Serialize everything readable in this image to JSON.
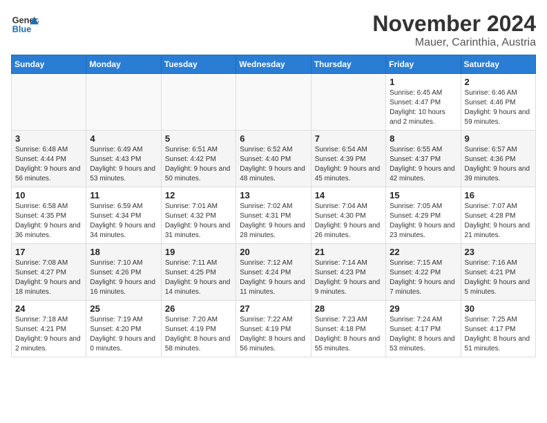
{
  "header": {
    "logo_general": "General",
    "logo_blue": "Blue",
    "month": "November 2024",
    "location": "Mauer, Carinthia, Austria"
  },
  "weekdays": [
    "Sunday",
    "Monday",
    "Tuesday",
    "Wednesday",
    "Thursday",
    "Friday",
    "Saturday"
  ],
  "weeks": [
    [
      {
        "day": "",
        "sunrise": "",
        "sunset": "",
        "daylight": ""
      },
      {
        "day": "",
        "sunrise": "",
        "sunset": "",
        "daylight": ""
      },
      {
        "day": "",
        "sunrise": "",
        "sunset": "",
        "daylight": ""
      },
      {
        "day": "",
        "sunrise": "",
        "sunset": "",
        "daylight": ""
      },
      {
        "day": "",
        "sunrise": "",
        "sunset": "",
        "daylight": ""
      },
      {
        "day": "1",
        "sunrise": "Sunrise: 6:45 AM",
        "sunset": "Sunset: 4:47 PM",
        "daylight": "Daylight: 10 hours and 2 minutes."
      },
      {
        "day": "2",
        "sunrise": "Sunrise: 6:46 AM",
        "sunset": "Sunset: 4:46 PM",
        "daylight": "Daylight: 9 hours and 59 minutes."
      }
    ],
    [
      {
        "day": "3",
        "sunrise": "Sunrise: 6:48 AM",
        "sunset": "Sunset: 4:44 PM",
        "daylight": "Daylight: 9 hours and 56 minutes."
      },
      {
        "day": "4",
        "sunrise": "Sunrise: 6:49 AM",
        "sunset": "Sunset: 4:43 PM",
        "daylight": "Daylight: 9 hours and 53 minutes."
      },
      {
        "day": "5",
        "sunrise": "Sunrise: 6:51 AM",
        "sunset": "Sunset: 4:42 PM",
        "daylight": "Daylight: 9 hours and 50 minutes."
      },
      {
        "day": "6",
        "sunrise": "Sunrise: 6:52 AM",
        "sunset": "Sunset: 4:40 PM",
        "daylight": "Daylight: 9 hours and 48 minutes."
      },
      {
        "day": "7",
        "sunrise": "Sunrise: 6:54 AM",
        "sunset": "Sunset: 4:39 PM",
        "daylight": "Daylight: 9 hours and 45 minutes."
      },
      {
        "day": "8",
        "sunrise": "Sunrise: 6:55 AM",
        "sunset": "Sunset: 4:37 PM",
        "daylight": "Daylight: 9 hours and 42 minutes."
      },
      {
        "day": "9",
        "sunrise": "Sunrise: 6:57 AM",
        "sunset": "Sunset: 4:36 PM",
        "daylight": "Daylight: 9 hours and 39 minutes."
      }
    ],
    [
      {
        "day": "10",
        "sunrise": "Sunrise: 6:58 AM",
        "sunset": "Sunset: 4:35 PM",
        "daylight": "Daylight: 9 hours and 36 minutes."
      },
      {
        "day": "11",
        "sunrise": "Sunrise: 6:59 AM",
        "sunset": "Sunset: 4:34 PM",
        "daylight": "Daylight: 9 hours and 34 minutes."
      },
      {
        "day": "12",
        "sunrise": "Sunrise: 7:01 AM",
        "sunset": "Sunset: 4:32 PM",
        "daylight": "Daylight: 9 hours and 31 minutes."
      },
      {
        "day": "13",
        "sunrise": "Sunrise: 7:02 AM",
        "sunset": "Sunset: 4:31 PM",
        "daylight": "Daylight: 9 hours and 28 minutes."
      },
      {
        "day": "14",
        "sunrise": "Sunrise: 7:04 AM",
        "sunset": "Sunset: 4:30 PM",
        "daylight": "Daylight: 9 hours and 26 minutes."
      },
      {
        "day": "15",
        "sunrise": "Sunrise: 7:05 AM",
        "sunset": "Sunset: 4:29 PM",
        "daylight": "Daylight: 9 hours and 23 minutes."
      },
      {
        "day": "16",
        "sunrise": "Sunrise: 7:07 AM",
        "sunset": "Sunset: 4:28 PM",
        "daylight": "Daylight: 9 hours and 21 minutes."
      }
    ],
    [
      {
        "day": "17",
        "sunrise": "Sunrise: 7:08 AM",
        "sunset": "Sunset: 4:27 PM",
        "daylight": "Daylight: 9 hours and 18 minutes."
      },
      {
        "day": "18",
        "sunrise": "Sunrise: 7:10 AM",
        "sunset": "Sunset: 4:26 PM",
        "daylight": "Daylight: 9 hours and 16 minutes."
      },
      {
        "day": "19",
        "sunrise": "Sunrise: 7:11 AM",
        "sunset": "Sunset: 4:25 PM",
        "daylight": "Daylight: 9 hours and 14 minutes."
      },
      {
        "day": "20",
        "sunrise": "Sunrise: 7:12 AM",
        "sunset": "Sunset: 4:24 PM",
        "daylight": "Daylight: 9 hours and 11 minutes."
      },
      {
        "day": "21",
        "sunrise": "Sunrise: 7:14 AM",
        "sunset": "Sunset: 4:23 PM",
        "daylight": "Daylight: 9 hours and 9 minutes."
      },
      {
        "day": "22",
        "sunrise": "Sunrise: 7:15 AM",
        "sunset": "Sunset: 4:22 PM",
        "daylight": "Daylight: 9 hours and 7 minutes."
      },
      {
        "day": "23",
        "sunrise": "Sunrise: 7:16 AM",
        "sunset": "Sunset: 4:21 PM",
        "daylight": "Daylight: 9 hours and 5 minutes."
      }
    ],
    [
      {
        "day": "24",
        "sunrise": "Sunrise: 7:18 AM",
        "sunset": "Sunset: 4:21 PM",
        "daylight": "Daylight: 9 hours and 2 minutes."
      },
      {
        "day": "25",
        "sunrise": "Sunrise: 7:19 AM",
        "sunset": "Sunset: 4:20 PM",
        "daylight": "Daylight: 9 hours and 0 minutes."
      },
      {
        "day": "26",
        "sunrise": "Sunrise: 7:20 AM",
        "sunset": "Sunset: 4:19 PM",
        "daylight": "Daylight: 8 hours and 58 minutes."
      },
      {
        "day": "27",
        "sunrise": "Sunrise: 7:22 AM",
        "sunset": "Sunset: 4:19 PM",
        "daylight": "Daylight: 8 hours and 56 minutes."
      },
      {
        "day": "28",
        "sunrise": "Sunrise: 7:23 AM",
        "sunset": "Sunset: 4:18 PM",
        "daylight": "Daylight: 8 hours and 55 minutes."
      },
      {
        "day": "29",
        "sunrise": "Sunrise: 7:24 AM",
        "sunset": "Sunset: 4:17 PM",
        "daylight": "Daylight: 8 hours and 53 minutes."
      },
      {
        "day": "30",
        "sunrise": "Sunrise: 7:25 AM",
        "sunset": "Sunset: 4:17 PM",
        "daylight": "Daylight: 8 hours and 51 minutes."
      }
    ]
  ]
}
